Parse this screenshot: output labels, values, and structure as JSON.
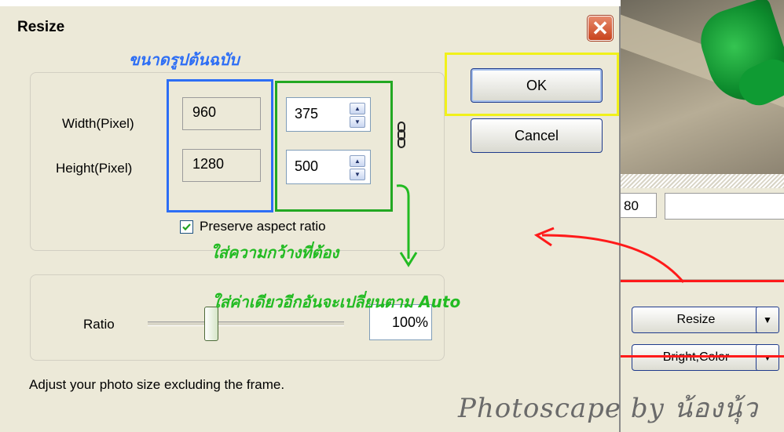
{
  "dialog": {
    "title": "Resize",
    "close_glyph": "✕",
    "width_label": "Width(Pixel)",
    "height_label": "Height(Pixel)",
    "original_width": "960",
    "original_height": "1280",
    "new_width": "375",
    "new_height": "500",
    "preserve_aspect_label": "Preserve aspect ratio",
    "preserve_aspect_checked": true,
    "ratio_label": "Ratio",
    "ratio_value": "100%",
    "ratio_slider_percent": 100,
    "ok_label": "OK",
    "cancel_label": "Cancel",
    "footer_text": "Adjust your photo size excluding the frame."
  },
  "background_app": {
    "field_value": "80",
    "resize_button_label": "Resize",
    "bright_color_button_label": "Bright,Color",
    "dropdown_glyph": "▼"
  },
  "annotations": {
    "original_size_note": "ขนาดรูปต้นฉบับ",
    "enter_width_note": "ใส่ความกว้างที่ต้อง",
    "auto_note": "ใส่ค่าเดียวอีกอันจะเปลี่ยนตาม Auto",
    "watermark": "Photoscape by น้องนุ้ว",
    "colors": {
      "blue": "#2d6ef5",
      "green": "#22a822",
      "yellow": "#f1f11a",
      "red": "#ff1a1a"
    }
  },
  "icons": {
    "chain": "chain-link-icon",
    "check": "checkmark-icon",
    "spin_up": "▲",
    "spin_down": "▼"
  }
}
